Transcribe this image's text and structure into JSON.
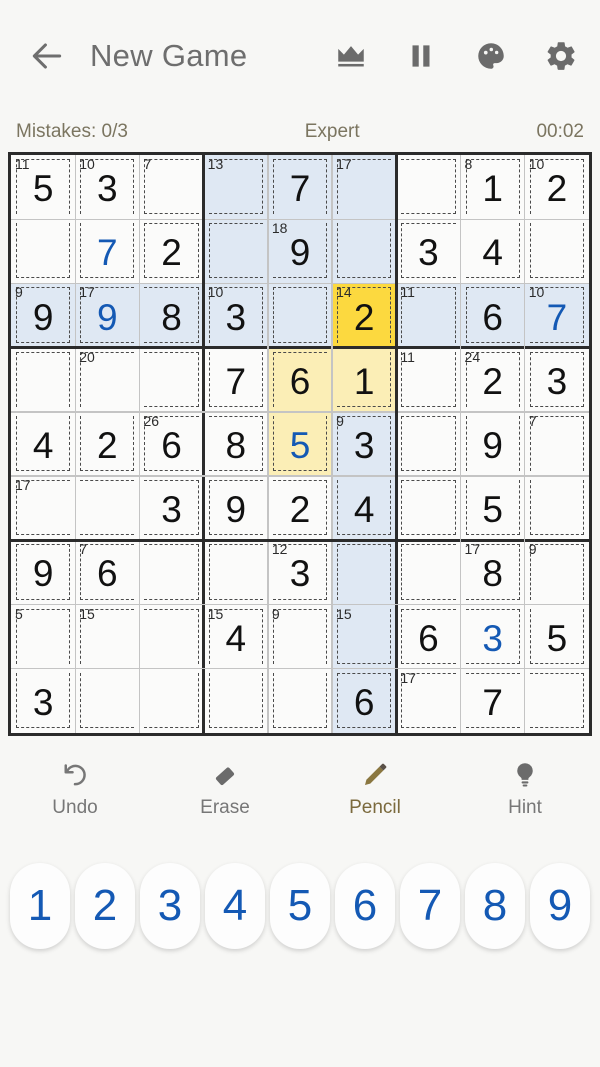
{
  "app": {
    "title": "New Game",
    "back_icon": "back-arrow-icon"
  },
  "appbar_actions": [
    {
      "name": "crown-icon",
      "label": "Crown"
    },
    {
      "name": "pause-icon",
      "label": "Pause"
    },
    {
      "name": "palette-icon",
      "label": "Theme"
    },
    {
      "name": "gear-icon",
      "label": "Settings"
    }
  ],
  "status": {
    "mistakes": "Mistakes: 0/3",
    "difficulty": "Expert",
    "timer": "00:02"
  },
  "colors": {
    "selected_cell": "#fcd93f",
    "selected_cage": "#fbeeb6",
    "highlight": "#dfe8f3",
    "user_value": "#1459b4",
    "given_value": "#111111",
    "accent": "#7b6a3d",
    "background": "#f7f7f5"
  },
  "board": {
    "size": 9,
    "selected": {
      "row": 2,
      "col": 5
    },
    "values": [
      [
        "5",
        "3",
        "",
        "",
        "7",
        "",
        "",
        "1",
        "2"
      ],
      [
        "",
        "7",
        "2",
        "",
        "9",
        "",
        "3",
        "4",
        ""
      ],
      [
        "9",
        "9",
        "8",
        "3",
        "",
        "2",
        "",
        "6",
        "7"
      ],
      [
        "",
        "",
        "",
        "7",
        "6",
        "1",
        "",
        "2",
        "3"
      ],
      [
        "4",
        "2",
        "6",
        "8",
        "5",
        "3",
        "",
        "9",
        ""
      ],
      [
        "",
        "",
        "3",
        "9",
        "2",
        "4",
        "",
        "5",
        ""
      ],
      [
        "9",
        "6",
        "",
        "",
        "3",
        "",
        "",
        "8",
        ""
      ],
      [
        "",
        "",
        "",
        "4",
        "",
        "",
        "6",
        "3",
        "5"
      ],
      [
        "3",
        "",
        "",
        "",
        "",
        "6",
        "",
        "7",
        ""
      ]
    ],
    "user_entered": [
      [
        false,
        false,
        false,
        false,
        false,
        false,
        false,
        false,
        false
      ],
      [
        false,
        true,
        false,
        false,
        false,
        false,
        false,
        false,
        false
      ],
      [
        false,
        true,
        false,
        false,
        false,
        false,
        false,
        false,
        true
      ],
      [
        false,
        false,
        false,
        false,
        false,
        false,
        false,
        false,
        false
      ],
      [
        false,
        false,
        false,
        false,
        true,
        false,
        false,
        false,
        false
      ],
      [
        false,
        false,
        false,
        false,
        false,
        false,
        false,
        false,
        false
      ],
      [
        false,
        false,
        false,
        false,
        false,
        false,
        false,
        false,
        false
      ],
      [
        false,
        false,
        false,
        false,
        false,
        false,
        false,
        true,
        false
      ],
      [
        false,
        false,
        false,
        false,
        false,
        false,
        false,
        false,
        false
      ]
    ],
    "cage_sums": {
      "0_0": "11",
      "0_1": "10",
      "0_2": "7",
      "0_3": "13",
      "0_5": "17",
      "0_7": "8",
      "0_8": "10",
      "1_4": "18",
      "2_0": "9",
      "2_1": "17",
      "2_3": "10",
      "2_5": "14",
      "2_6": "11",
      "2_8": "10",
      "3_1": "20",
      "3_6": "11",
      "3_7": "24",
      "4_2": "26",
      "4_5": "9",
      "4_8": "7",
      "5_0": "17",
      "6_1": "7",
      "6_4": "12",
      "6_7": "17",
      "6_8": "9",
      "7_0": "5",
      "7_1": "15",
      "7_3": "15",
      "7_4": "9",
      "7_5": "15",
      "8_6": "17"
    },
    "cage_groups": [
      [
        "0_0",
        "1_0"
      ],
      [
        "0_1",
        "1_1"
      ],
      [
        "0_2",
        "0_3"
      ],
      [
        "0_4",
        "1_4",
        "1_3"
      ],
      [
        "0_5",
        "1_5",
        "0_6"
      ],
      [
        "0_7",
        "1_7",
        "1_6"
      ],
      [
        "0_8",
        "1_8"
      ],
      [
        "1_2"
      ],
      [
        "2_0"
      ],
      [
        "2_1",
        "2_2"
      ],
      [
        "2_3",
        "3_3"
      ],
      [
        "2_4",
        "2_5_x"
      ],
      [
        "2_5",
        "3_5",
        "3_4",
        "4_4"
      ],
      [
        "2_6",
        "3_6"
      ],
      [
        "2_7",
        "2_8"
      ],
      [
        "3_0",
        "4_0"
      ],
      [
        "3_1",
        "3_2",
        "4_1"
      ],
      [
        "3_7",
        "4_7",
        "5_7"
      ],
      [
        "3_8"
      ],
      [
        "4_2",
        "4_3"
      ],
      [
        "4_5",
        "5_5"
      ],
      [
        "4_8",
        "5_8"
      ],
      [
        "5_0",
        "5_1",
        "5_2"
      ],
      [
        "5_3",
        "5_4"
      ],
      [
        "6_0"
      ],
      [
        "6_1",
        "6_2"
      ],
      [
        "6_3",
        "6_4"
      ],
      [
        "6_5",
        "7_5"
      ],
      [
        "6_6",
        "6_7"
      ],
      [
        "6_8",
        "7_8"
      ],
      [
        "7_0",
        "8_0"
      ],
      [
        "7_1",
        "7_2",
        "8_1",
        "8_2"
      ],
      [
        "7_3",
        "8_3"
      ],
      [
        "7_4",
        "8_4"
      ],
      [
        "7_6",
        "7_7"
      ],
      [
        "8_5"
      ],
      [
        "8_6",
        "8_7",
        "8_8"
      ]
    ],
    "highlight_cells": "box2-row3-col6",
    "selected_cage_cells": [
      [
        2,
        5
      ],
      [
        3,
        5
      ],
      [
        3,
        4
      ],
      [
        4,
        4
      ]
    ]
  },
  "actions": [
    {
      "name": "undo-action",
      "icon": "undo-icon",
      "label": "Undo",
      "accent": false
    },
    {
      "name": "erase-action",
      "icon": "eraser-icon",
      "label": "Erase",
      "accent": false
    },
    {
      "name": "pencil-action",
      "icon": "pencil-icon",
      "label": "Pencil",
      "accent": true
    },
    {
      "name": "hint-action",
      "icon": "bulb-icon",
      "label": "Hint",
      "accent": false
    }
  ],
  "numpad": [
    "1",
    "2",
    "3",
    "4",
    "5",
    "6",
    "7",
    "8",
    "9"
  ]
}
